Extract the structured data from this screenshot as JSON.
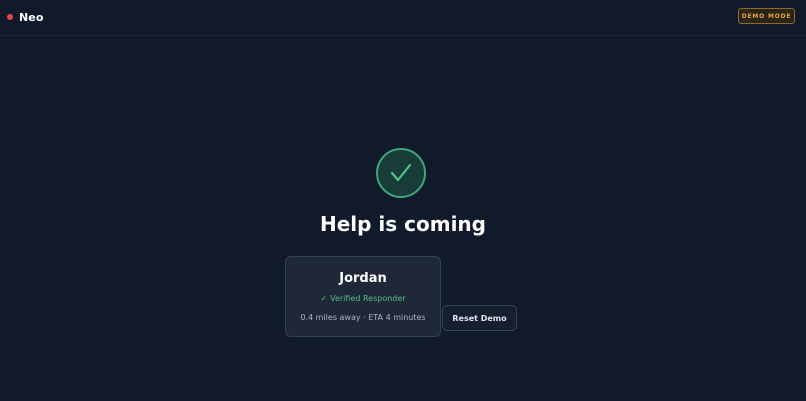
{
  "app": {
    "name": "Neo",
    "status_color": "#e5484d"
  },
  "header": {
    "demo_badge": "DEMO MODE"
  },
  "status": {
    "icon": "check-icon",
    "accent_color": "#3fa777",
    "headline": "Help is coming"
  },
  "responder": {
    "name": "Jordan",
    "verified_check": "✓",
    "verified_label": "Verified Responder",
    "details": "0.4 miles away · ETA 4 minutes"
  },
  "actions": {
    "reset_label": "Reset Demo"
  }
}
